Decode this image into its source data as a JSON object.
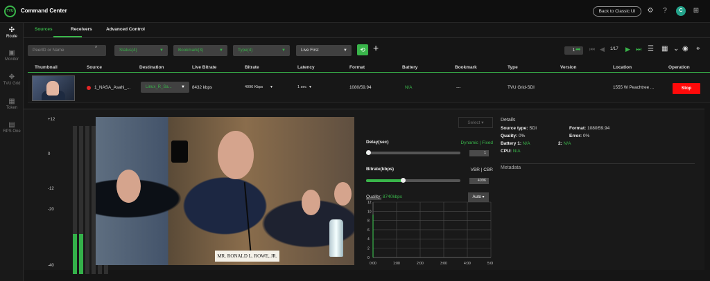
{
  "app": {
    "logo_text": "TVU",
    "title": "Command Center",
    "classic_button": "Back to Classic UI",
    "avatar": "C",
    "icons": {
      "settings": "gear-icon",
      "help": "help-icon",
      "apps": "apps-icon"
    }
  },
  "nav": [
    {
      "label": "Route",
      "icon": "route-icon",
      "glyph": "✣"
    },
    {
      "label": "Monitor",
      "icon": "monitor-icon",
      "glyph": "▣"
    },
    {
      "label": "TVU Grid",
      "icon": "grid-network-icon",
      "glyph": "✥"
    },
    {
      "label": "Token",
      "icon": "qr-code-icon",
      "glyph": "▦"
    },
    {
      "label": "RPS One",
      "icon": "rps-one-icon",
      "glyph": "▤"
    }
  ],
  "tabs": [
    "Sources",
    "Receivers",
    "Advanced Control"
  ],
  "filters": {
    "search_placeholder": "PeerID or Name",
    "status": "Status(4)",
    "bookmark": "Bookmark(3)",
    "type": "Type(4)",
    "sort": "Live First",
    "add": "+"
  },
  "pager": {
    "page": "1",
    "count": "1/17"
  },
  "table": {
    "headers": [
      "Thumbnail",
      "Source",
      "Destination",
      "Live Bitrate",
      "Bitrate",
      "Latency",
      "Format",
      "Battery",
      "Bookmark",
      "Type",
      "Version",
      "Location",
      "Operation"
    ],
    "row": {
      "source": "1_NASA_Asahi_...",
      "destination": "Linux_R_Sa...",
      "live_bitrate": "8432 kbps",
      "bitrate": "4096 Kbps",
      "latency": "1 sec",
      "format": "1080/59.94",
      "battery": "N/A",
      "bookmark": "---",
      "type": "TVU Grid-SDI",
      "version": "",
      "location": "1555 W Peachtree ...",
      "operation": "Stop"
    }
  },
  "meter": {
    "labels": [
      "+12",
      "0",
      "-12",
      "-20",
      "-40"
    ],
    "fill_percent": 27
  },
  "video": {
    "nameplate": "MR. RONALD L. ROWE, JR."
  },
  "controls": {
    "select": "Select",
    "delay_label": "Delay(sec)",
    "delay_mode": "Dynamic | Fixed",
    "delay_value": "1",
    "delay_fraction": 0.02,
    "bitrate_label": "Bitrate(kbps)",
    "bitrate_mode": "VBR | CBR",
    "bitrate_value": "4096",
    "bitrate_fraction": 0.39,
    "quality_label": "Quality:",
    "quality_value": "8740kbps",
    "quality_mode": "Auto",
    "chart_x_labels": [
      "0:00",
      "1:00",
      "2:00",
      "3:00",
      "4:00",
      "5:00"
    ],
    "chart_y_labels": [
      "12",
      "10",
      "8",
      "6",
      "4",
      "2",
      "0"
    ]
  },
  "details": {
    "title": "Details",
    "source_type_label": "Source type:",
    "source_type": "SDI",
    "format_label": "Format:",
    "format": "1080i59.94",
    "quality_label": "Quality:",
    "quality": "0%",
    "error_label": "Error:",
    "error": "0%",
    "battery1_label": "Battery 1:",
    "battery1": "N/A",
    "battery2_label": "2:",
    "battery2": "N/A",
    "cpu_label": "CPU:",
    "cpu": "N/A",
    "metadata_title": "Metadata"
  },
  "colors": {
    "accent": "#39b54a",
    "danger": "#ff0a0a",
    "background": "#151515"
  }
}
